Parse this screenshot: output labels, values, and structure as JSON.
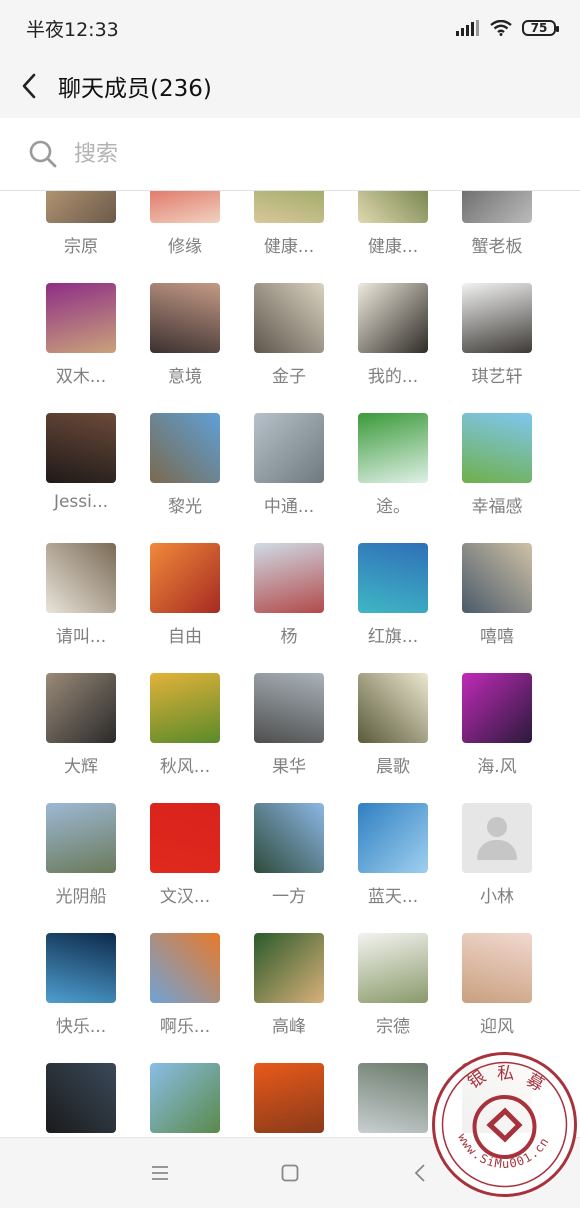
{
  "status_bar": {
    "time": "半夜12:33",
    "battery": "75"
  },
  "header": {
    "title": "聊天成员(236)"
  },
  "search": {
    "placeholder": "搜索"
  },
  "members": [
    {
      "name": "宗原",
      "colors": [
        "#c9a77f",
        "#6b5a4a"
      ]
    },
    {
      "name": "修缘",
      "colors": [
        "#d63a2e",
        "#f1d2c0"
      ]
    },
    {
      "name": "健康...",
      "colors": [
        "#7a9a4a",
        "#d9c79a"
      ]
    },
    {
      "name": "健康...",
      "colors": [
        "#556b2f",
        "#e0d8b0"
      ]
    },
    {
      "name": "蟹老板",
      "colors": [
        "#555555",
        "#bbbbbb"
      ]
    },
    {
      "name": "双木...",
      "colors": [
        "#8e2d86",
        "#c9a37a"
      ]
    },
    {
      "name": "意境",
      "colors": [
        "#c59a86",
        "#3b3130"
      ]
    },
    {
      "name": "金子",
      "colors": [
        "#d9d2c0",
        "#5f574d"
      ]
    },
    {
      "name": "我的...",
      "colors": [
        "#efeade",
        "#2e2b26"
      ]
    },
    {
      "name": "琪艺轩",
      "colors": [
        "#f2f2f2",
        "#3d3a36"
      ]
    },
    {
      "name": "Jessi...",
      "colors": [
        "#6b4a3a",
        "#1f1a18"
      ]
    },
    {
      "name": "黎光",
      "colors": [
        "#5fa0d8",
        "#7a6a4e"
      ]
    },
    {
      "name": "中通...",
      "colors": [
        "#b6c1c9",
        "#6e7a7f"
      ]
    },
    {
      "name": "途。",
      "colors": [
        "#3b9a3a",
        "#dff0e6"
      ]
    },
    {
      "name": "幸福感",
      "colors": [
        "#7fc6ef",
        "#6fb04a"
      ]
    },
    {
      "name": "请叫...",
      "colors": [
        "#7a6a55",
        "#e9e4da"
      ]
    },
    {
      "name": "自由",
      "colors": [
        "#f08a3a",
        "#a62a22"
      ]
    },
    {
      "name": "杨",
      "colors": [
        "#cfdbe6",
        "#b24a4a"
      ]
    },
    {
      "name": "红旗...",
      "colors": [
        "#2f6fb8",
        "#3fb7c4"
      ]
    },
    {
      "name": "嘻嘻",
      "colors": [
        "#cfc1a6",
        "#4a5a6a"
      ]
    },
    {
      "name": "大辉",
      "colors": [
        "#9a8a78",
        "#2a2a2a"
      ]
    },
    {
      "name": "秋风...",
      "colors": [
        "#e2b23a",
        "#5a8a2a"
      ]
    },
    {
      "name": "果华",
      "colors": [
        "#a9b3b9",
        "#4e4e4e"
      ]
    },
    {
      "name": "晨歌",
      "colors": [
        "#ece7cf",
        "#5a5a3a"
      ]
    },
    {
      "name": "海.风",
      "colors": [
        "#c02ab8",
        "#2a1a3a"
      ]
    },
    {
      "name": "光阴船",
      "colors": [
        "#9db8d4",
        "#6a7a5a"
      ]
    },
    {
      "name": "文汉...",
      "colors": [
        "#d8221c",
        "#e02a1e"
      ]
    },
    {
      "name": "一方",
      "colors": [
        "#8cb8e6",
        "#2f4a3a"
      ]
    },
    {
      "name": "蓝天...",
      "colors": [
        "#2f7fc2",
        "#9fd0ef"
      ]
    },
    {
      "name": "小林",
      "colors": [
        "#e6e6e6",
        "#e6e6e6"
      ],
      "placeholder": true
    },
    {
      "name": "快乐...",
      "colors": [
        "#0d2a4a",
        "#4f9fd0"
      ]
    },
    {
      "name": "啊乐...",
      "colors": [
        "#e87a2a",
        "#6fa3d6"
      ]
    },
    {
      "name": "高峰",
      "colors": [
        "#2a5a2a",
        "#d9b07a"
      ]
    },
    {
      "name": "宗德",
      "colors": [
        "#f3f3f0",
        "#8a9a6a"
      ]
    },
    {
      "name": "迎风",
      "colors": [
        "#f1d8cf",
        "#c9a07f"
      ]
    },
    {
      "name": "",
      "colors": [
        "#3a4a5a",
        "#1a1a1a"
      ]
    },
    {
      "name": "",
      "colors": [
        "#8abde6",
        "#5a8a4a"
      ]
    },
    {
      "name": "",
      "colors": [
        "#e85a1a",
        "#8a3a1a"
      ]
    },
    {
      "name": "",
      "colors": [
        "#6a7a6a",
        "#c9cfd2"
      ]
    },
    {
      "name": "",
      "colors": [
        "#d8c8b0",
        "#444444"
      ]
    }
  ],
  "watermark": {
    "text": "www.SiMu001.cn",
    "brand": "银 私 募"
  }
}
